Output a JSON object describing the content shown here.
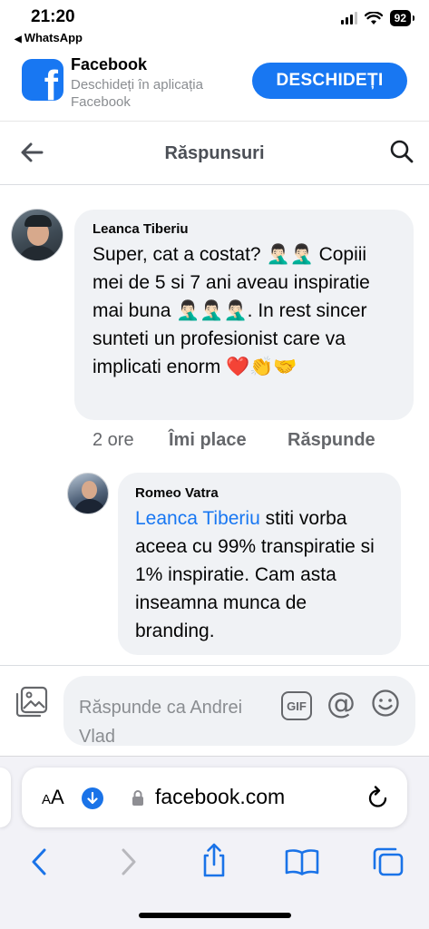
{
  "status_bar": {
    "time": "21:20",
    "back_app": "WhatsApp",
    "battery": "92"
  },
  "app_banner": {
    "app_name": "Facebook",
    "subtitle": "Deschideți în aplicația Facebook",
    "open_button": "DESCHIDEȚI",
    "brand_color": "#1877f2"
  },
  "header": {
    "title": "Răspunsuri",
    "back_icon": "arrow-left-icon",
    "search_icon": "search-icon"
  },
  "comments": [
    {
      "author": "Leanca Tiberiu",
      "text": "Super, cat a costat? 🤦🏻‍♂️🤦🏻‍♂️ Copiii mei de 5 si 7 ani aveau inspiratie mai buna 🤦🏻‍♂️🤦🏻‍♂️🤦🏻‍♂️. In rest sincer sunteti un profesionist care va implicati enorm ❤️👏🤝",
      "time": "2 ore",
      "like_label": "Îmi place",
      "reply_label": "Răspunde"
    },
    {
      "author": "Romeo Vatra",
      "mention": "Leanca Tiberiu",
      "text": " stiti vorba aceea cu 99% transpiratie si 1% inspiratie. Cam asta inseamna munca de branding."
    }
  ],
  "composer": {
    "placeholder": "Răspunde ca Andrei Vlad",
    "gif_label": "GIF",
    "at_symbol": "@"
  },
  "safari": {
    "text_size_label_big": "A",
    "text_size_label_small": "A",
    "url": "facebook.com"
  }
}
